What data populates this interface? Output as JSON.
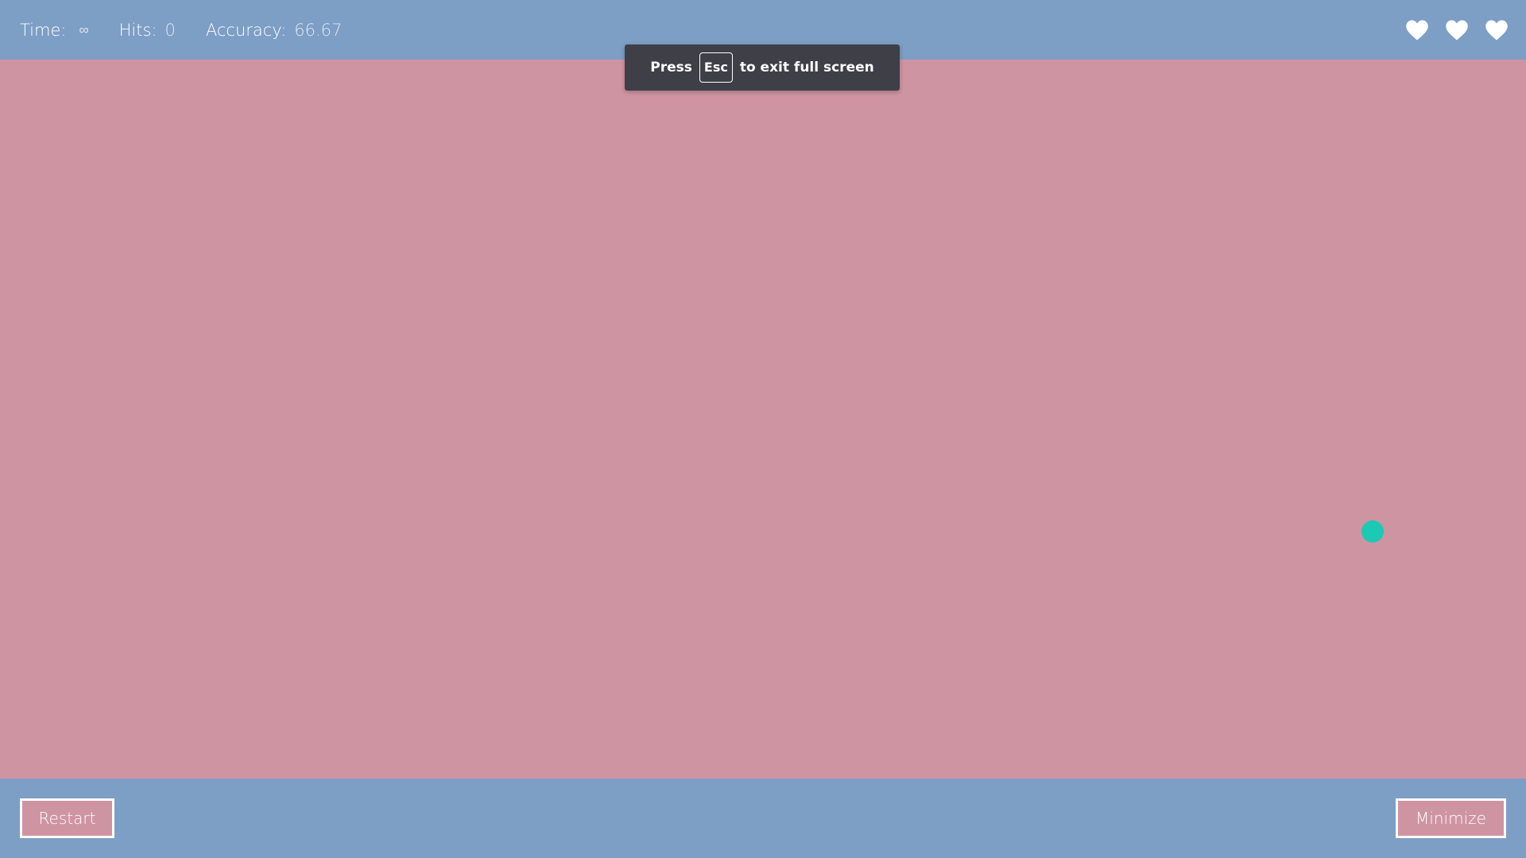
{
  "topbar": {
    "stats": [
      {
        "label": "Time:",
        "value": "∞"
      },
      {
        "label": "Hits:",
        "value": "0"
      },
      {
        "label": "Accuracy:",
        "value": "66.67"
      }
    ],
    "lives": 3
  },
  "toast": {
    "prefix": "Press",
    "key": "Esc",
    "suffix": "to exit full screen"
  },
  "buttons": {
    "restart_label": "Restart",
    "minimize_label": "Minimize"
  },
  "colors": {
    "bar": "#7d9ec5",
    "field": "#cf94a2",
    "target": "#1cc9b4",
    "toast": "#3f3f47"
  },
  "icons": {
    "life": "heart-icon"
  }
}
